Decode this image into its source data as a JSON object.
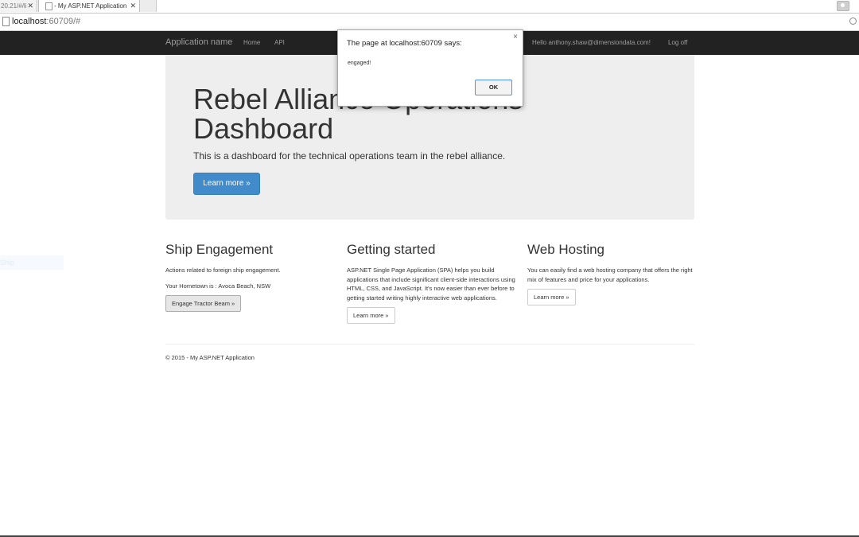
{
  "browser": {
    "tabs": [
      {
        "title": "20.21/#/li",
        "close": "✕"
      },
      {
        "title": "- My ASP.NET Application",
        "close": "✕"
      }
    ],
    "url_host": "localhost",
    "url_rest": ":60709/#"
  },
  "navbar": {
    "brand": "Application name",
    "links": [
      "Home",
      "API"
    ],
    "user_greeting": "Hello anthony.shaw@dimensiondata.com!",
    "logoff": "Log off"
  },
  "jumbotron": {
    "title": "Rebel Alliance Operations Dashboard",
    "lead": "This is a dashboard for the technical operations team in the rebel alliance.",
    "button": "Learn more »"
  },
  "columns": {
    "ship": {
      "heading": "Ship Engagement",
      "text": "Actions related to foreign ship engagement.",
      "hometown": "Your Hometown is : Avoca Beach, NSW",
      "button": "Engage Tractor Beam »"
    },
    "started": {
      "heading": "Getting started",
      "text": "ASP.NET Single Page Application (SPA) helps you build applications that include significant client-side interactions using HTML, CSS, and JavaScript. It's now easier than ever before to getting started writing highly interactive web applications.",
      "button": "Learn more »"
    },
    "hosting": {
      "heading": "Web Hosting",
      "text": "You can easily find a web hosting company that offers the right mix of features and price for your applications.",
      "button": "Learn more »"
    }
  },
  "footer": "© 2015 - My ASP.NET Application",
  "ghost_item": "Ship",
  "dialog": {
    "title": "The page at localhost:60709 says:",
    "message": "engaged!",
    "ok": "OK",
    "close": "×"
  },
  "colors": {
    "navbar_bg": "#222222",
    "primary": "#428bca",
    "jumbotron_bg": "#eeeeee"
  }
}
